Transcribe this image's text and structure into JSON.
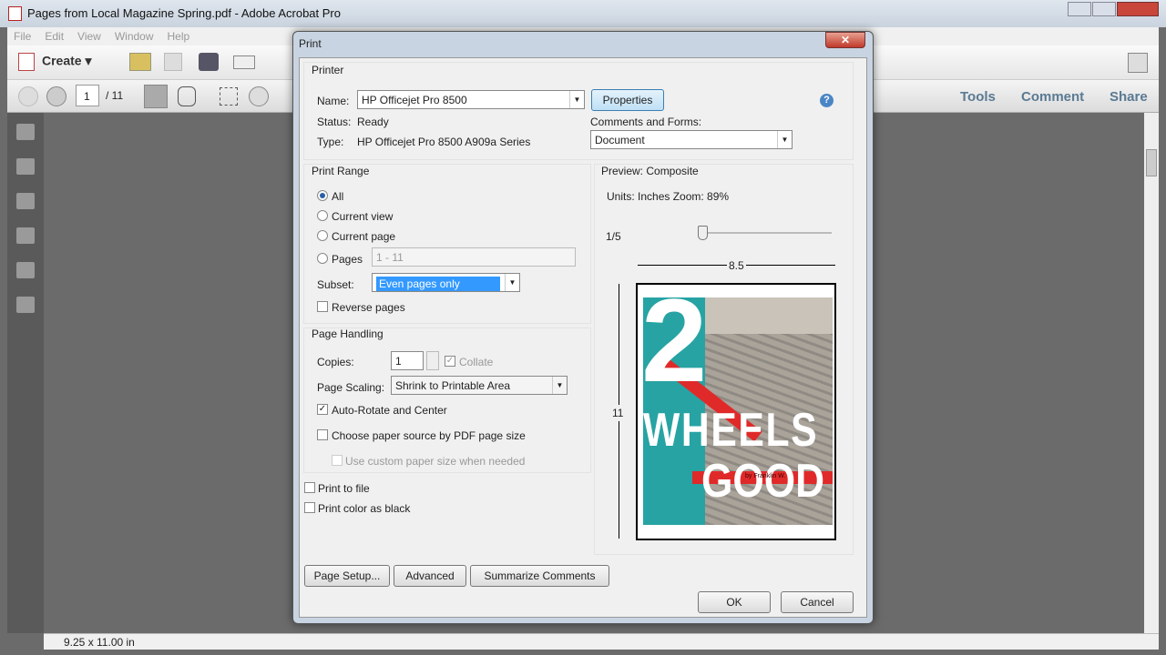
{
  "window": {
    "title": "Pages from Local Magazine Spring.pdf - Adobe Acrobat Pro"
  },
  "menu": [
    "File",
    "Edit",
    "View",
    "Window",
    "Help"
  ],
  "toolbar": {
    "create": "Create",
    "page_current": "1",
    "page_total": "/ 11",
    "tools": "Tools",
    "comment": "Comment",
    "share": "Share"
  },
  "status": {
    "page_size": "9.25 x 11.00 in"
  },
  "dialog": {
    "title": "Print",
    "close": "✕",
    "printer": {
      "group": "Printer",
      "name_label": "Name:",
      "name_value": "HP Officejet Pro 8500",
      "properties": "Properties",
      "status_label": "Status:",
      "status_value": "Ready",
      "type_label": "Type:",
      "type_value": "HP Officejet Pro 8500 A909a Series",
      "comments_label": "Comments and Forms:",
      "comments_value": "Document",
      "help": "?"
    },
    "range": {
      "group": "Print Range",
      "all": "All",
      "current_view": "Current view",
      "current_page": "Current page",
      "pages": "Pages",
      "pages_value": "1 - 11",
      "subset_label": "Subset:",
      "subset_value": "Even pages only",
      "reverse": "Reverse pages",
      "selected": "All"
    },
    "handling": {
      "group": "Page Handling",
      "copies_label": "Copies:",
      "copies_value": "1",
      "collate": "Collate",
      "scaling_label": "Page Scaling:",
      "scaling_value": "Shrink to Printable Area",
      "auto_rotate": "Auto-Rotate and Center",
      "paper_source": "Choose paper source by PDF page size",
      "custom_paper": "Use custom paper size when needed"
    },
    "print_to_file": "Print to file",
    "print_black": "Print color as black",
    "preview": {
      "group": "Preview: Composite",
      "units": "Units: Inches Zoom:  89%",
      "page": "1/5",
      "width": "8.5",
      "height": "11",
      "cover_number": "2",
      "cover_line1": "WHEELS",
      "cover_line2": "GOOD",
      "cover_byline": "by Franklin W."
    },
    "buttons": {
      "page_setup": "Page Setup...",
      "advanced": "Advanced",
      "summarize": "Summarize Comments",
      "ok": "OK",
      "cancel": "Cancel"
    }
  }
}
